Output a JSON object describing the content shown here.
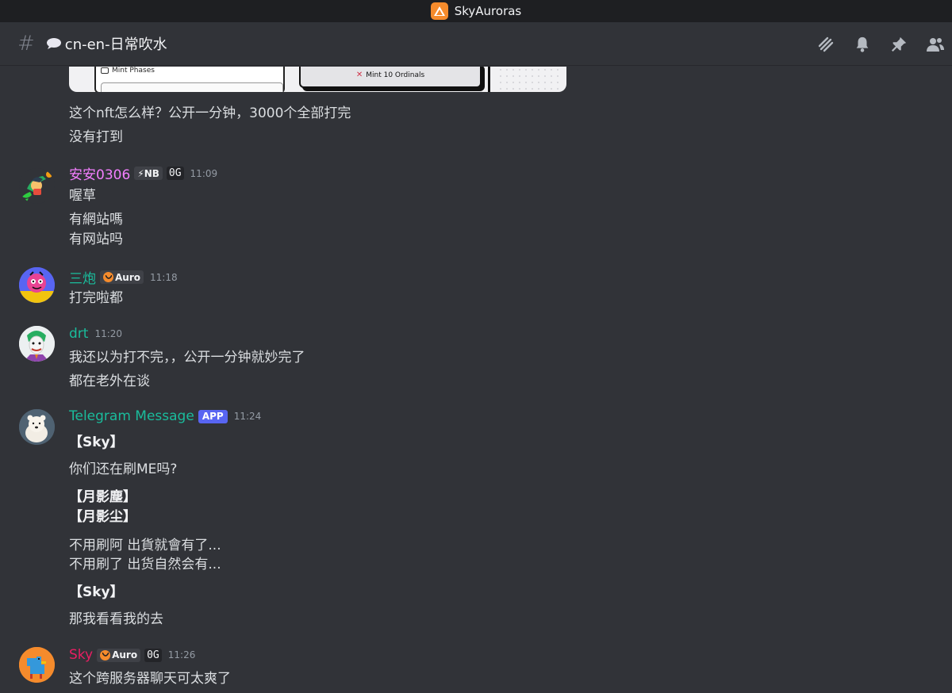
{
  "window": {
    "title": "SkyAuroras"
  },
  "channel": {
    "name": "cn-en-日常吹水"
  },
  "colors": {
    "accent_orange": "#f58b2c",
    "username_pink": "#f47fff",
    "username_teal": "#1abc9c",
    "username_sky": "#e91e63",
    "app_badge": "#5865f2"
  },
  "embed": {
    "phases_label": "Mint Phases",
    "button_label": "Mint 10 Ordinals"
  },
  "messages": [
    {
      "lines": [
        "这个nft怎么样？公开一分钟，3000个全部打完",
        "没有打到"
      ]
    },
    {
      "username": "安安0306",
      "tag1": "⚡NB",
      "tag2": "0G",
      "time": "11:09",
      "lines": [
        "喔草",
        "有網站嗎",
        "有网站吗"
      ]
    },
    {
      "username": "三炮",
      "tag1": "Auro",
      "time": "11:18",
      "lines": [
        "打完啦都"
      ]
    },
    {
      "username": "drt",
      "time": "11:20",
      "lines": [
        "我还以为打不完，，公开一分钟就妙完了",
        "都在老外在谈"
      ]
    },
    {
      "username": "Telegram Message",
      "badge": "APP",
      "time": "11:24",
      "lines": [
        "【Sky】",
        "你们还在刷ME吗?",
        "【月影塵】",
        "【月影尘】",
        "不用刷阿 出貨就會有了...",
        "不用刷了 出货自然会有...",
        "【Sky】",
        "那我看看我的去"
      ]
    },
    {
      "username": "Sky",
      "tag1": "Auro",
      "tag2": "0G",
      "time": "11:26",
      "lines": [
        "这个跨服务器聊天可太爽了"
      ]
    }
  ]
}
